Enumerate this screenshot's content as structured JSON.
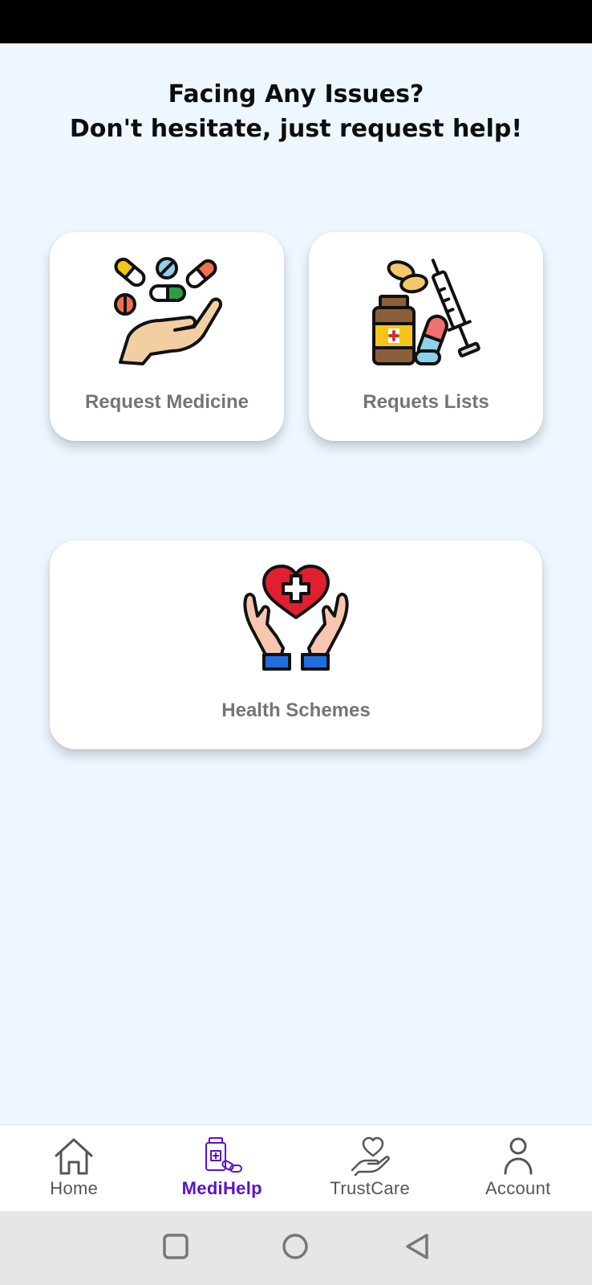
{
  "header": {
    "line1": "Facing Any Issues?",
    "line2": "Don't hesitate, just request help!"
  },
  "cards": {
    "request_medicine": {
      "label": "Request Medicine",
      "icon": "hand-with-pills-icon"
    },
    "request_lists": {
      "label": "Requets Lists",
      "icon": "medicine-bottle-syringe-icon"
    },
    "health_schemes": {
      "label": "Health Schemes",
      "icon": "hands-holding-heart-icon"
    }
  },
  "bottom_nav": {
    "items": [
      {
        "label": "Home",
        "icon": "home-icon",
        "active": false
      },
      {
        "label": "MediHelp",
        "icon": "medicine-icon",
        "active": true
      },
      {
        "label": "TrustCare",
        "icon": "hand-heart-icon",
        "active": false
      },
      {
        "label": "Account",
        "icon": "person-icon",
        "active": false
      }
    ],
    "active_color": "#5B12C6"
  },
  "system_nav": [
    "square-recents-icon",
    "circle-home-icon",
    "triangle-back-icon"
  ],
  "colors": {
    "background": "#EEF6FF",
    "card": "#FFFFFF",
    "label_gray": "#757575"
  }
}
